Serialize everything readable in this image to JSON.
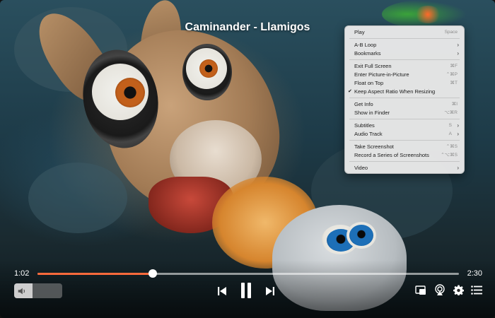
{
  "video": {
    "title": "Caminander - Llamigos"
  },
  "playback": {
    "elapsed": "1:02",
    "total": "2:30",
    "progress": 0.274,
    "volume": 0.38,
    "accent_color": "#ff6a3c"
  },
  "controls": {
    "volume_icon": "speaker-icon",
    "previous_icon": "skip-previous-icon",
    "pause_icon": "pause-icon",
    "next_icon": "skip-next-icon",
    "pip_icon": "picture-in-picture-icon",
    "airplay_icon": "airplay-icon",
    "settings_icon": "gear-icon",
    "playlist_icon": "playlist-icon"
  },
  "context_menu": {
    "items": [
      {
        "label": "Play",
        "shortcut": "Space"
      },
      {
        "label": "A-B Loop"
      },
      {
        "label": "Bookmarks"
      },
      {
        "label": "Exit Full Screen",
        "shortcut": "⌘F"
      },
      {
        "label": "Enter Picture-in-Picture",
        "shortcut": "⌃⌘P"
      },
      {
        "label": "Float on Top",
        "shortcut": "⌘T"
      },
      {
        "label": "Keep Aspect Ratio When Resizing"
      },
      {
        "label": "Get Info",
        "shortcut": "⌘I"
      },
      {
        "label": "Show in Finder",
        "shortcut": "⌥⌘R"
      },
      {
        "label": "Subtitles",
        "shortcut": "S"
      },
      {
        "label": "Audio Track",
        "shortcut": "A"
      },
      {
        "label": "Take Screenshot",
        "shortcut": "⌃⌘S"
      },
      {
        "label": "Record a Series of Screenshots",
        "shortcut": "⌃⌥⌘S"
      },
      {
        "label": "Video"
      }
    ]
  }
}
